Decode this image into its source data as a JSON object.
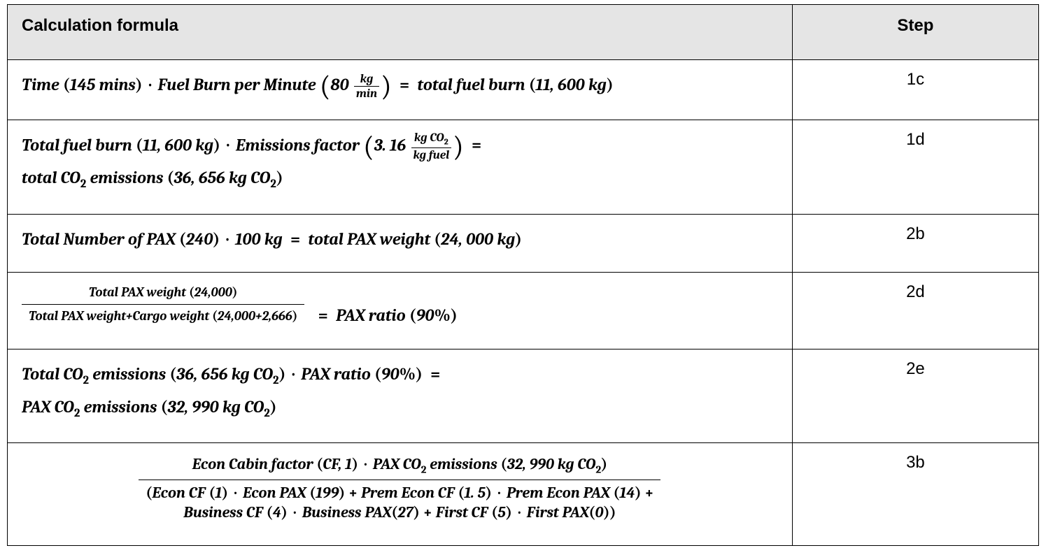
{
  "chart_data": {
    "type": "table",
    "title": "Calculation formula / Step",
    "columns": [
      "Calculation formula",
      "Step"
    ],
    "rows": [
      {
        "step": "1c",
        "formula_text": "Time (145 mins) · Fuel Burn per Minute (80 kg/min) = total fuel burn (11,600 kg)",
        "inputs": {
          "time_min": 145,
          "fuel_burn_per_min_kg": 80
        },
        "output": {
          "total_fuel_burn_kg": 11600
        }
      },
      {
        "step": "1d",
        "formula_text": "Total fuel burn (11,600 kg) · Emissions factor (3.16 kg CO2 / kg fuel) = total CO2 emissions (36,656 kg CO2)",
        "inputs": {
          "total_fuel_burn_kg": 11600,
          "emissions_factor_kgCO2_per_kgfuel": 3.16
        },
        "output": {
          "total_co2_kg": 36656
        }
      },
      {
        "step": "2b",
        "formula_text": "Total Number of PAX (240) · 100 kg = total PAX weight (24,000 kg)",
        "inputs": {
          "pax_count": 240,
          "kg_per_pax": 100
        },
        "output": {
          "total_pax_weight_kg": 24000
        }
      },
      {
        "step": "2d",
        "formula_text": "Total PAX weight (24,000) / (Total PAX weight + Cargo weight (24,000 + 2,666)) = PAX ratio (90%)",
        "inputs": {
          "total_pax_weight_kg": 24000,
          "cargo_weight_kg": 2666
        },
        "output": {
          "pax_ratio_pct": 90
        }
      },
      {
        "step": "2e",
        "formula_text": "Total CO2 emissions (36,656 kg CO2) · PAX ratio (90%) = PAX CO2 emissions (32,990 kg CO2)",
        "inputs": {
          "total_co2_kg": 36656,
          "pax_ratio_pct": 90
        },
        "output": {
          "pax_co2_kg": 32990
        }
      },
      {
        "step": "3b",
        "formula_text": "Econ Cabin factor (CF, 1) · PAX CO2 emissions (32,990 kg CO2) / (Econ CF (1) · Econ PAX (199) + Prem Econ CF (1.5) · Prem Econ PAX (14) + Business CF (4) · Business PAX (27) + First CF (5) · First PAX (0))",
        "inputs": {
          "econ_cf": 1,
          "econ_pax": 199,
          "prem_econ_cf": 1.5,
          "prem_econ_pax": 14,
          "business_cf": 4,
          "business_pax": 27,
          "first_cf": 5,
          "first_pax": 0,
          "pax_co2_kg": 32990
        }
      }
    ]
  },
  "headers": {
    "formula": "Calculation formula",
    "step": "Step"
  },
  "rows": {
    "r0": {
      "step": "1c",
      "time_label": "Time",
      "time_value": "145",
      "time_unit": "mins",
      "fuel_burn_label": "Fuel Burn per Minute",
      "fuel_burn_value": "80",
      "frac_num": "kg",
      "frac_den": "min",
      "eq": "=",
      "result_label": "total fuel burn",
      "result_value": "11, 600",
      "result_unit": "kg"
    },
    "r1": {
      "step": "1d",
      "fuel_burn_label": "Total fuel burn",
      "fuel_burn_value": "11, 600",
      "fuel_burn_unit": "kg",
      "ef_label": "Emissions factor",
      "ef_value": "3. 16",
      "ef_num1": "kg CO",
      "ef_num_sub": "2",
      "ef_den": "kg fuel",
      "eq": "=",
      "result_label_l1": "",
      "result_label": "total CO",
      "result_sub": "2",
      "result_label2": " emissions",
      "result_value": "36, 656",
      "result_unit": "kg CO",
      "result_unit_sub": "2"
    },
    "r2": {
      "step": "2b",
      "pax_label": "Total Number of PAX",
      "pax_value": "240",
      "per_pax": "100",
      "per_pax_unit": "kg",
      "eq": "=",
      "result_label": "total PAX weight",
      "result_value": "24, 000",
      "result_unit": "kg"
    },
    "r3": {
      "step": "2d",
      "num_label": "Total PAX weight",
      "num_value": "24,000",
      "den_label": "Total PAX weight+Cargo weight",
      "den_value": "24,000+2,666",
      "eq": "=",
      "result_label": "PAX ratio",
      "result_value": "90",
      "result_unit": "%"
    },
    "r4": {
      "step": "2e",
      "co2_label": "Total CO",
      "co2_sub": "2",
      "co2_label2": " emissions",
      "co2_value": "36, 656",
      "co2_unit": "kg CO",
      "co2_unit_sub": "2",
      "ratio_label": "PAX ratio",
      "ratio_value": "90",
      "ratio_unit": "%",
      "eq": "=",
      "result_label": "PAX CO",
      "result_sub": "2",
      "result_label2": " emissions",
      "result_value": "32, 990",
      "result_unit": "kg CO",
      "result_unit_sub": "2"
    },
    "r5": {
      "step": "3b",
      "num_a": "Econ Cabin factor",
      "num_a_paren": "CF,  1",
      "num_b": "PAX CO",
      "num_b_sub": "2",
      "num_b2": " emissions",
      "num_b_value": "32, 990",
      "num_b_unit": "kg CO",
      "num_b_unit_sub": "2",
      "den_e_cf_l": "Econ CF",
      "den_e_cf_v": "1",
      "den_e_pax_l": "Econ PAX",
      "den_e_pax_v": "199",
      "den_pe_cf_l": "Prem Econ CF",
      "den_pe_cf_v": "1. 5",
      "den_pe_pax_l": "Prem Econ PAX",
      "den_pe_pax_v": "14",
      "den_b_cf_l": "Business CF",
      "den_b_cf_v": "4",
      "den_b_pax_l": "Business PAX",
      "den_b_pax_v": "27",
      "den_f_cf_l": "First CF",
      "den_f_cf_v": "5",
      "den_f_pax_l": "First PAX",
      "den_f_pax_v": "0"
    }
  }
}
